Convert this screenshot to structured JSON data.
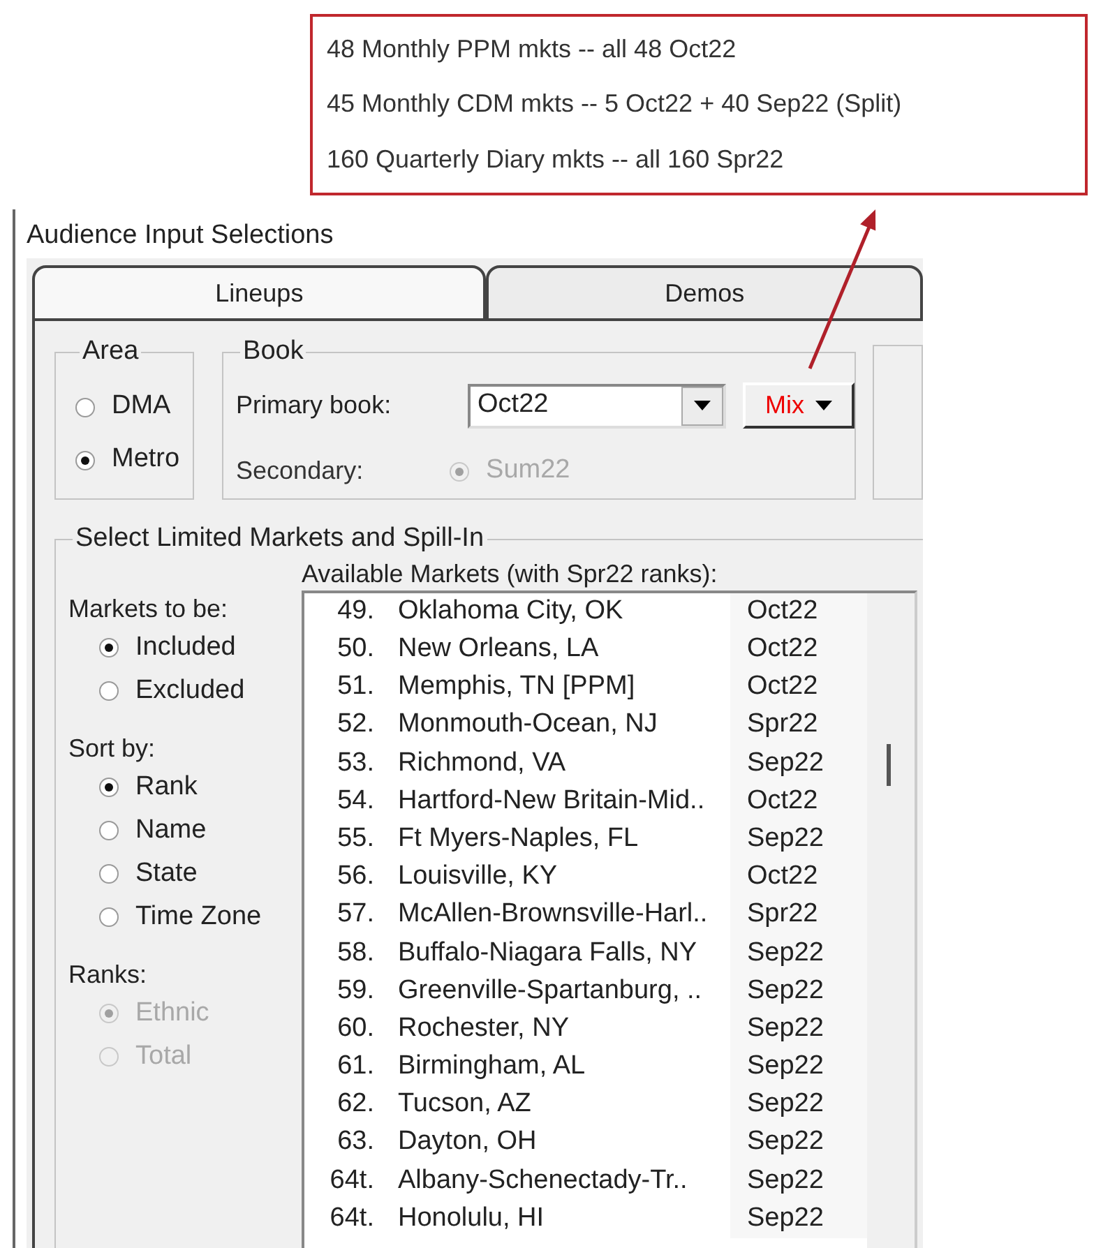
{
  "callout": {
    "lines": [
      "48 Monthly PPM mkts -- all 48 Oct22",
      "45 Monthly CDM mkts -- 5 Oct22 + 40 Sep22 (Split)",
      "160 Quarterly Diary mkts -- all 160 Spr22"
    ]
  },
  "window": {
    "title": "Audience Input Selections"
  },
  "tabs": [
    {
      "label": "Lineups",
      "selected": true
    },
    {
      "label": "Demos",
      "selected": false
    }
  ],
  "area": {
    "title": "Area",
    "options": [
      {
        "label": "DMA",
        "selected": false,
        "disabled": false
      },
      {
        "label": "Metro",
        "selected": true,
        "disabled": false
      }
    ]
  },
  "book": {
    "title": "Book",
    "primary_label": "Primary book:",
    "primary_value": "Oct22",
    "mix_button": "Mix",
    "secondary_label": "Secondary:",
    "secondary_option": {
      "label": "Sum22",
      "selected": true,
      "disabled": true
    }
  },
  "limited": {
    "title": "Select Limited Markets and Spill-In",
    "groups": [
      {
        "label": "Markets to be:",
        "options": [
          {
            "label": "Included",
            "selected": true,
            "disabled": false
          },
          {
            "label": "Excluded",
            "selected": false,
            "disabled": false
          }
        ]
      },
      {
        "label": "Sort by:",
        "options": [
          {
            "label": "Rank",
            "selected": true,
            "disabled": false
          },
          {
            "label": "Name",
            "selected": false,
            "disabled": false
          },
          {
            "label": "State",
            "selected": false,
            "disabled": false
          },
          {
            "label": "Time Zone",
            "selected": false,
            "disabled": false
          }
        ]
      },
      {
        "label": "Ranks:",
        "options": [
          {
            "label": "Ethnic",
            "selected": true,
            "disabled": true
          },
          {
            "label": "Total",
            "selected": false,
            "disabled": true
          }
        ]
      }
    ],
    "list_label": "Available Markets (with Spr22 ranks):",
    "markets": [
      {
        "rank": "49.",
        "name": "Oklahoma City, OK",
        "book": "Oct22"
      },
      {
        "rank": "50.",
        "name": "New Orleans, LA",
        "book": "Oct22"
      },
      {
        "rank": "51.",
        "name": "Memphis, TN [PPM]",
        "book": "Oct22"
      },
      {
        "rank": "52.",
        "name": "Monmouth-Ocean, NJ",
        "book": "Spr22"
      },
      {
        "rank": "53.",
        "name": "Richmond, VA",
        "book": "Sep22"
      },
      {
        "rank": "54.",
        "name": "Hartford-New Britain-Mid..",
        "book": "Oct22"
      },
      {
        "rank": "55.",
        "name": "Ft Myers-Naples, FL",
        "book": "Sep22"
      },
      {
        "rank": "56.",
        "name": "Louisville, KY",
        "book": "Oct22"
      },
      {
        "rank": "57.",
        "name": "McAllen-Brownsville-Harl..",
        "book": "Spr22"
      },
      {
        "rank": "58.",
        "name": "Buffalo-Niagara Falls, NY",
        "book": "Sep22"
      },
      {
        "rank": "59.",
        "name": "Greenville-Spartanburg, ..",
        "book": "Sep22"
      },
      {
        "rank": "60.",
        "name": "Rochester, NY",
        "book": "Sep22"
      },
      {
        "rank": "61.",
        "name": "Birmingham, AL",
        "book": "Sep22"
      },
      {
        "rank": "62.",
        "name": "Tucson, AZ",
        "book": "Sep22"
      },
      {
        "rank": "63.",
        "name": "Dayton, OH",
        "book": "Sep22"
      },
      {
        "rank": "64t.",
        "name": "Albany-Schenectady-Tr..",
        "book": "Sep22"
      },
      {
        "rank": "64t.",
        "name": "Honolulu, HI",
        "book": "Sep22"
      }
    ]
  }
}
